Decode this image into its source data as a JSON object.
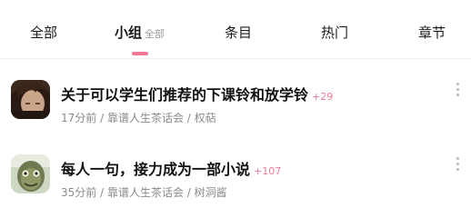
{
  "tabs": [
    {
      "label": "全部"
    },
    {
      "label": "小组",
      "sub": "全部"
    },
    {
      "label": "条目"
    },
    {
      "label": "热门"
    },
    {
      "label": "章节"
    }
  ],
  "active_tab": "小组",
  "posts": [
    {
      "title": "关于可以学生们推荐的下课铃和放学铃",
      "count": "+29",
      "time": "17分前",
      "group": "靠谱人生茶话会",
      "author": "权萜"
    },
    {
      "title": "每人一句，接力成为一部小说",
      "count": "+107",
      "time": "35分前",
      "group": "靠谱人生茶话会",
      "author": "树洞酱"
    }
  ],
  "meta_separator": " / ",
  "colors": {
    "accent": "#f07a96",
    "meta_text": "#8a8a8a"
  },
  "icons": {
    "more": "vertical-ellipsis-icon"
  }
}
